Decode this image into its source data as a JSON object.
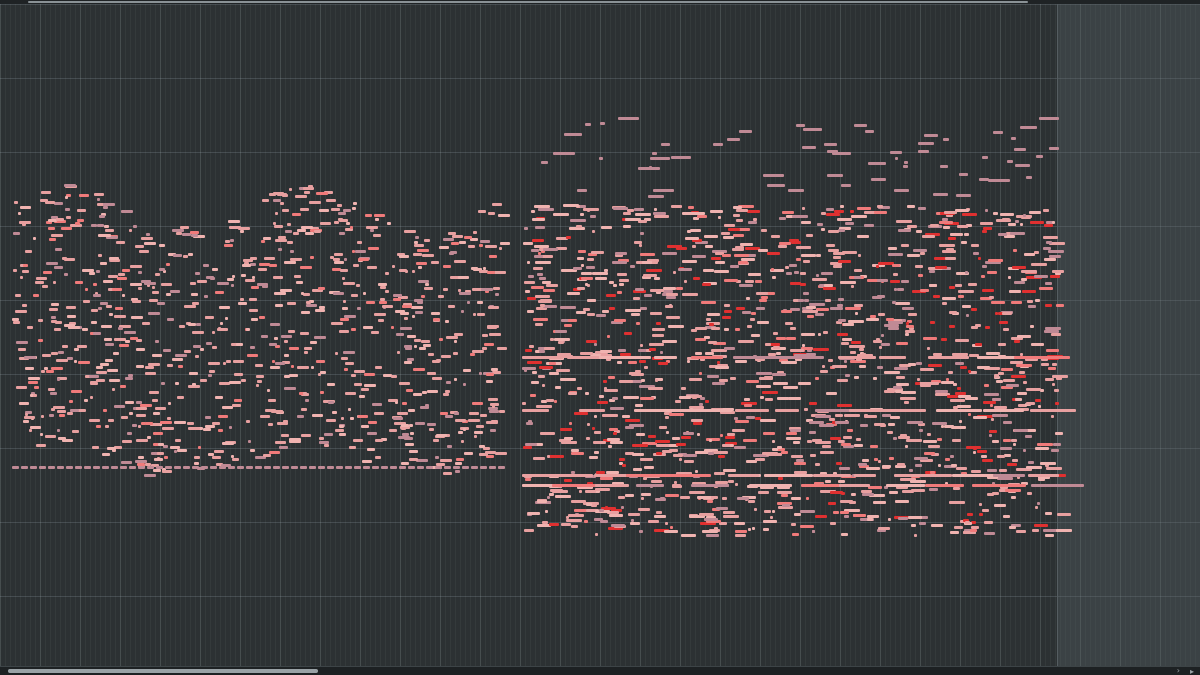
{
  "app": {
    "view": "piano-roll",
    "note_count_display": "",
    "colors": {
      "background": "#2c3133",
      "note_default": "#e8a0a0",
      "note_light": "#f0b3b0",
      "note_muted": "#c08a95",
      "note_hot": "#e03030",
      "note_accent": "#f07a7a"
    }
  },
  "scroll": {
    "horizontal_position": 0.0,
    "horizontal_thumb_fraction": 0.26,
    "right_arrow_icon": "chevron-right-icon",
    "end_icon": "scroll-end-icon",
    "right_arrow_glyph": "›",
    "end_glyph": "▸"
  }
}
